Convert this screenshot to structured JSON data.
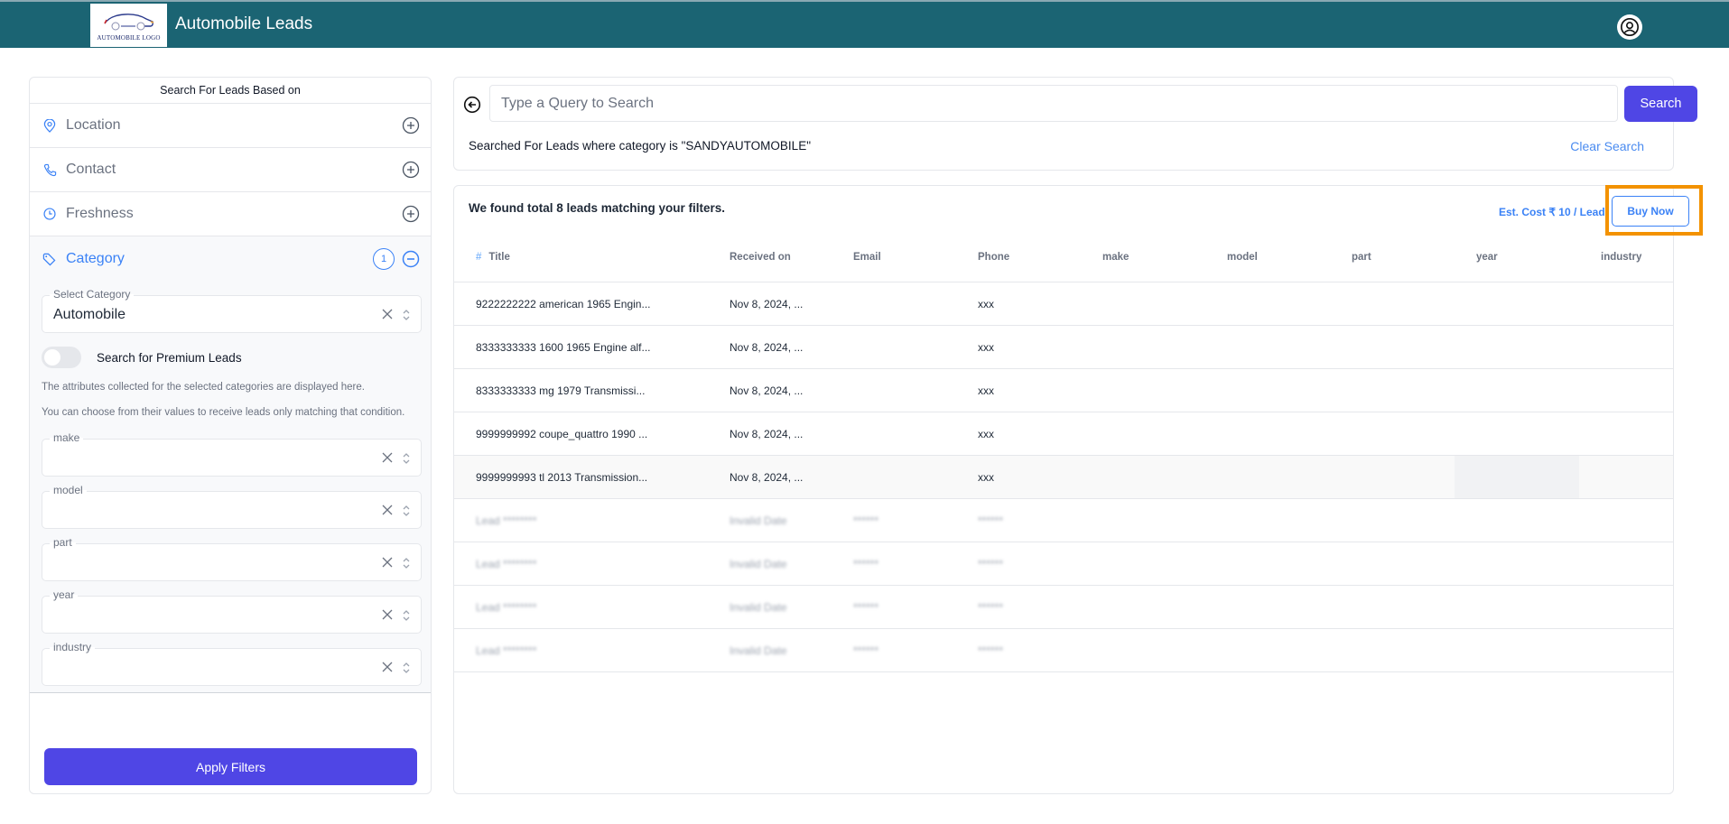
{
  "header": {
    "logo_text": "AUTOMOBILE LOGO",
    "title": "Automobile Leads",
    "user_icon": "user-circle-icon",
    "bg_color": "#1b6473"
  },
  "sidebar": {
    "heading": "Search For Leads Based on",
    "items": [
      {
        "label": "Location",
        "icon": "map-pin-icon"
      },
      {
        "label": "Contact",
        "icon": "phone-icon"
      },
      {
        "label": "Freshness",
        "icon": "clock-icon"
      }
    ],
    "category": {
      "label": "Category",
      "icon": "tag-icon",
      "badge_count": "1",
      "select_label": "Select Category",
      "select_value": "Automobile",
      "premium_toggle_label": "Search for Premium Leads",
      "premium_toggle_on": false,
      "hint_1": "The attributes collected for the selected categories are displayed here.",
      "hint_2": "You can choose from their values to receive leads only matching that condition.",
      "attributes": [
        {
          "label": "make",
          "value": ""
        },
        {
          "label": "model",
          "value": ""
        },
        {
          "label": "part",
          "value": ""
        },
        {
          "label": "year",
          "value": ""
        },
        {
          "label": "industry",
          "value": ""
        }
      ]
    },
    "apply_label": "Apply Filters"
  },
  "search": {
    "placeholder": "Type a Query to Search",
    "value": "",
    "button_label": "Search",
    "searched_text": "Searched For Leads where category is \"SANDYAUTOMOBILE\"",
    "clear_label": "Clear Search"
  },
  "results": {
    "found_text": "We found total 8 leads matching your filters.",
    "est_cost": "Est. Cost ₹ 10 / Lead",
    "buy_label": "Buy Now",
    "columns": [
      "#",
      "Title",
      "Received on",
      "Email",
      "Phone",
      "make",
      "model",
      "part",
      "year",
      "industry"
    ],
    "rows": [
      {
        "title": "9222222222 american 1965 Engin...",
        "received": "Nov 8, 2024, ...",
        "email": "",
        "phone": "xxx"
      },
      {
        "title": "8333333333 1600 1965 Engine alf...",
        "received": "Nov 8, 2024, ...",
        "email": "",
        "phone": "xxx"
      },
      {
        "title": "8333333333 mg 1979 Transmissi...",
        "received": "Nov 8, 2024, ...",
        "email": "",
        "phone": "xxx"
      },
      {
        "title": "9999999992 coupe_quattro 1990 ...",
        "received": "Nov 8, 2024, ...",
        "email": "",
        "phone": "xxx"
      },
      {
        "title": "9999999993 tl 2013 Transmission...",
        "received": "Nov 8, 2024, ...",
        "email": "",
        "phone": "xxx"
      }
    ],
    "locked_rows": [
      {
        "title": "Lead ********",
        "received": "Invalid Date",
        "email": "******",
        "phone": "******"
      },
      {
        "title": "Lead ********",
        "received": "Invalid Date",
        "email": "******",
        "phone": "******"
      },
      {
        "title": "Lead ********",
        "received": "Invalid Date",
        "email": "******",
        "phone": "******"
      },
      {
        "title": "Lead ********",
        "received": "Invalid Date",
        "email": "******",
        "phone": "******"
      }
    ]
  },
  "colors": {
    "primary": "#4f46e5",
    "accent_blue": "#3b82f6",
    "highlight": "#f39200"
  }
}
